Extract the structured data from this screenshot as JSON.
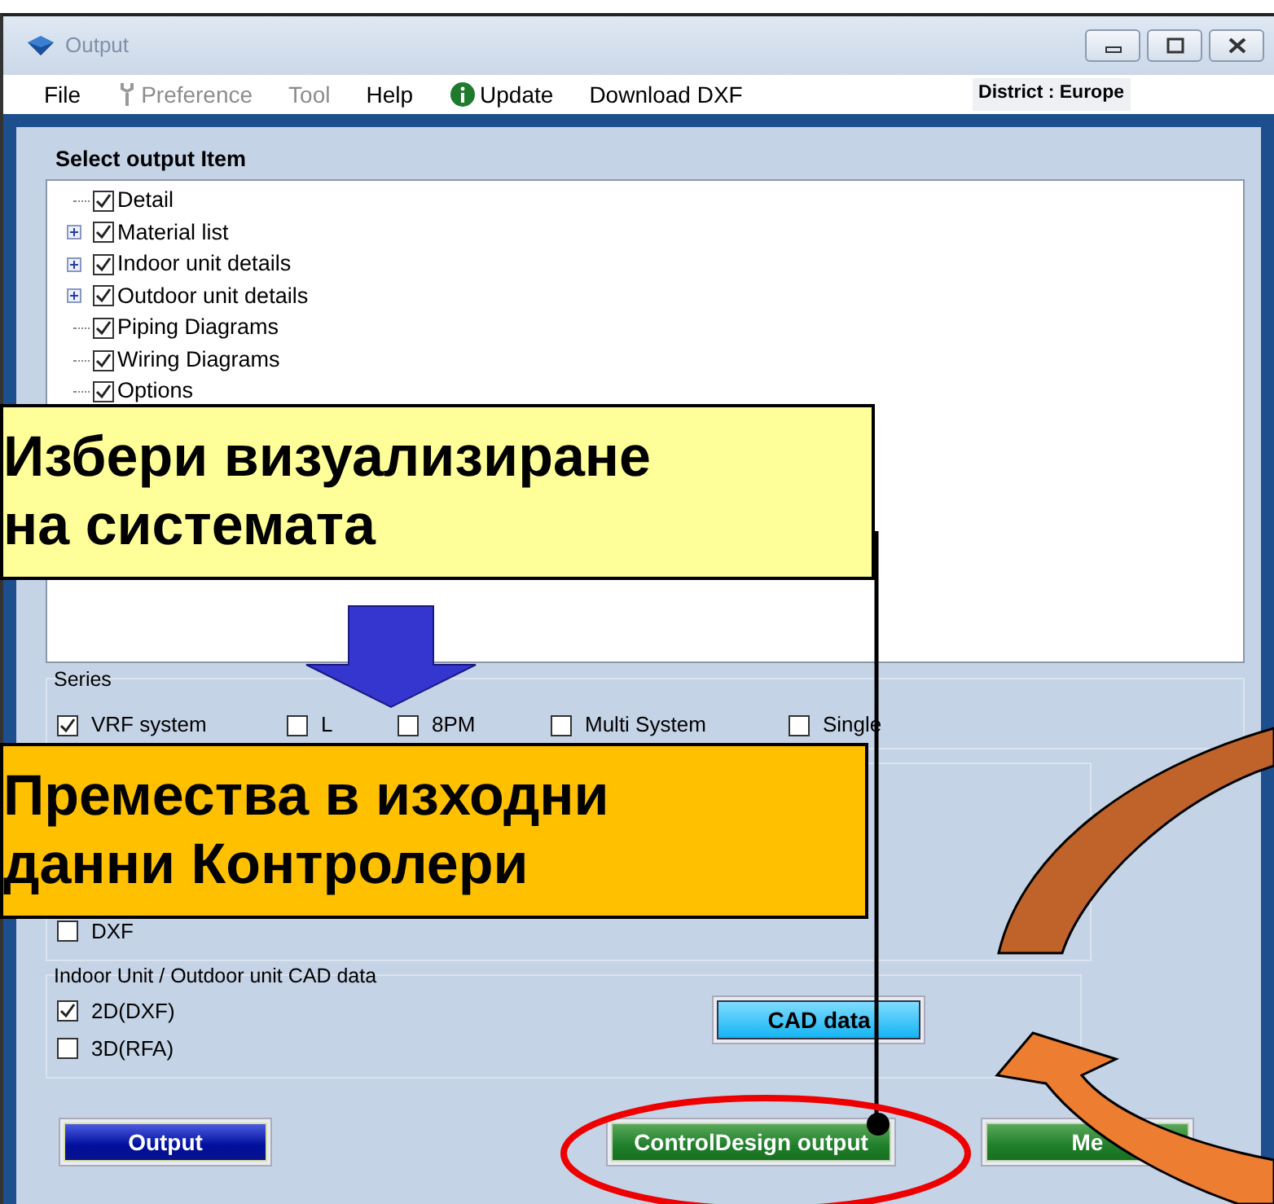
{
  "window": {
    "title": "Output"
  },
  "menu": [
    {
      "label": "File",
      "disabled": false
    },
    {
      "label": "Preference",
      "disabled": true,
      "kind": "wrench"
    },
    {
      "label": "Tool",
      "disabled": true
    },
    {
      "label": "Help",
      "disabled": false
    },
    {
      "label": "Update",
      "disabled": false,
      "kind": "info"
    },
    {
      "label": "Download DXF",
      "disabled": false
    }
  ],
  "district": "District : Europe",
  "output_items": {
    "title": "Select output Item",
    "items": [
      {
        "label": "Detail",
        "checked": true,
        "expandable": false
      },
      {
        "label": "Material list",
        "checked": true,
        "expandable": true
      },
      {
        "label": "Indoor unit details",
        "checked": true,
        "expandable": true
      },
      {
        "label": "Outdoor unit details",
        "checked": true,
        "expandable": true
      },
      {
        "label": "Piping Diagrams",
        "checked": true,
        "expandable": false
      },
      {
        "label": "Wiring Diagrams",
        "checked": true,
        "expandable": false
      },
      {
        "label": "Options",
        "checked": true,
        "expandable": false
      }
    ]
  },
  "series": {
    "title": "Series",
    "options": [
      {
        "label": "VRF system",
        "checked": true
      },
      {
        "label": "L",
        "checked": false
      },
      {
        "label": "8PM",
        "checked": false
      },
      {
        "label": "Multi System",
        "checked": false
      },
      {
        "label": "Single",
        "checked": false
      }
    ]
  },
  "dxf": {
    "label": "DXF",
    "checked": false
  },
  "cad_data": {
    "title": "Indoor Unit / Outdoor unit CAD data",
    "options": [
      {
        "label": "2D(DXF)",
        "checked": true
      },
      {
        "label": "3D(RFA)",
        "checked": false
      }
    ],
    "button": "CAD data"
  },
  "buttons": [
    {
      "label": "Output",
      "kind": "blue"
    },
    {
      "label": "ControlDesign output",
      "kind": "green"
    },
    {
      "label": "Me",
      "kind": "green"
    }
  ],
  "callouts": [
    {
      "text": "Избери визуализиране на системата",
      "kind": "light"
    },
    {
      "text": "Премества в изходни данни Контролери",
      "kind": "orange"
    }
  ]
}
